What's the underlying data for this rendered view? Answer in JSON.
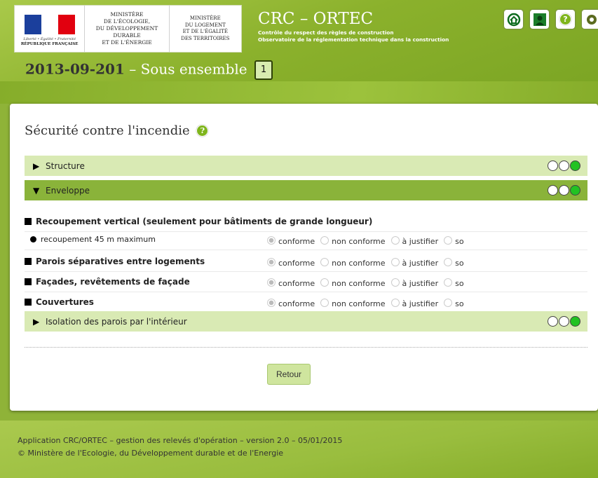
{
  "header": {
    "logo_rf": {
      "motto": "Liberté • Égalité • Fraternité",
      "republique": "RÉPUBLIQUE FRANÇAISE"
    },
    "ministry1": [
      "MINISTÈRE",
      "DE L'ÉCOLOGIE,",
      "DU DÉVELOPPEMENT",
      "DURABLE",
      "ET DE L'ÉNERGIE"
    ],
    "ministry2": [
      "MINISTÈRE",
      "DU LOGEMENT",
      "ET DE L'ÉGALITÉ",
      "DES TERRITOIRES"
    ],
    "app_title": "CRC – ORTEC",
    "app_sub1": "Contrôle du respect des règles de construction",
    "app_sub2": "Observatoire de la réglementation technique dans la construction",
    "icons": [
      "home-icon",
      "user-icon",
      "help-icon",
      "settings-icon"
    ],
    "help_glyph": "?"
  },
  "breadcrumb": {
    "code": "2013-09-201",
    "separator": "–",
    "label": "Sous ensemble",
    "number": "1"
  },
  "section": {
    "title": "Sécurité contre l'incendie",
    "help_glyph": "?"
  },
  "accordions": [
    {
      "label": "Structure",
      "arrow": "▶",
      "open": false,
      "lights": [
        "#ffffff",
        "#ffffff",
        "#22c222"
      ]
    },
    {
      "label": "Enveloppe",
      "arrow": "▼",
      "open": true,
      "lights": [
        "#ffffff",
        "#ffffff",
        "#22c222"
      ]
    },
    {
      "label": "Isolation des parois par l'intérieur",
      "arrow": "▶",
      "open": false,
      "lights": [
        "#ffffff",
        "#ffffff",
        "#22c222"
      ]
    }
  ],
  "options": [
    "conforme",
    "non conforme",
    "à justifier",
    "so"
  ],
  "questions": [
    {
      "label": "Recoupement vertical (seulement pour bâtiments de grande longueur)",
      "has_options": false
    },
    {
      "label": "recoupement 45 m maximum",
      "has_options": true,
      "sub": true
    },
    {
      "label": "Parois séparatives entre logements",
      "has_options": true
    },
    {
      "label": "Façades, revêtements de façade",
      "has_options": true
    },
    {
      "label": "Couvertures",
      "has_options": true
    }
  ],
  "button": {
    "label": "Retour"
  },
  "footer": {
    "line1": "Application CRC/ORTEC – gestion des relevés d'opération – version 2.0 – 05/01/2015",
    "line2": "© Ministère de l'Ecologie, du Développement durable et de l'Energie"
  },
  "colors": {
    "accent_green": "#8ab33a",
    "accordion_light": "#d9eab4",
    "light_on": "#22c222"
  }
}
